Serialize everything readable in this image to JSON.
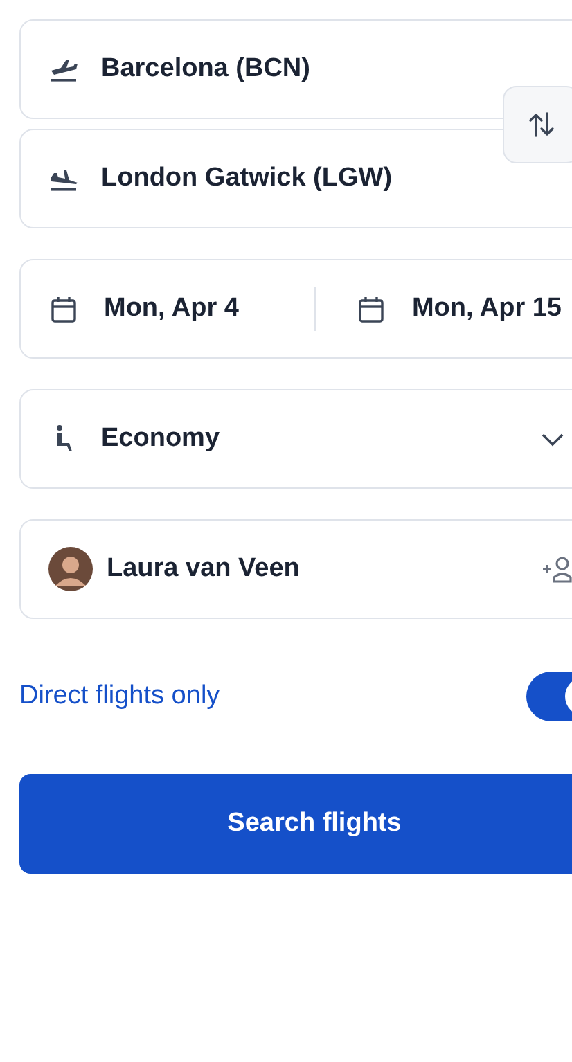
{
  "route": {
    "origin": "Barcelona (BCN)",
    "destination": "London Gatwick (LGW)"
  },
  "dates": {
    "departure": "Mon, Apr 4",
    "return": "Mon, Apr 15"
  },
  "cabin_class": "Economy",
  "passengers": [
    {
      "name": "Laura van Veen"
    }
  ],
  "direct_flights_only": {
    "label": "Direct flights only",
    "on": true
  },
  "search_button": "Search flights"
}
